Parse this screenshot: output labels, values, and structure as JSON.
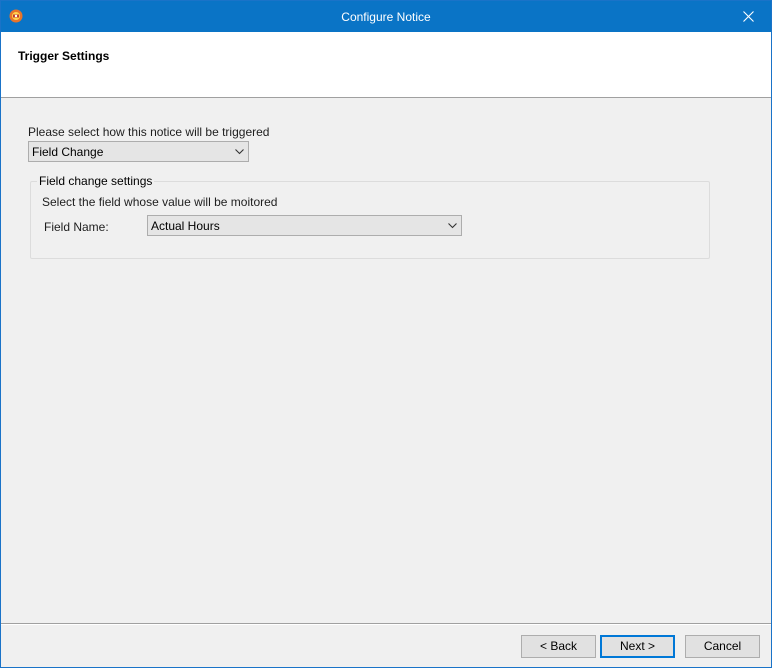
{
  "window": {
    "title": "Configure Notice"
  },
  "header": {
    "title": "Trigger Settings"
  },
  "trigger": {
    "prompt": "Please select how this notice will be triggered",
    "selected": "Field Change"
  },
  "field_change": {
    "legend": "Field change settings",
    "instruction": "Select the field whose value will be moitored",
    "field_label": "Field Name:",
    "field_selected": "Actual Hours"
  },
  "buttons": {
    "back": "< Back",
    "next": "Next >",
    "cancel": "Cancel"
  },
  "colors": {
    "titlebar": "#0a74c6",
    "accent": "#0078d7"
  }
}
